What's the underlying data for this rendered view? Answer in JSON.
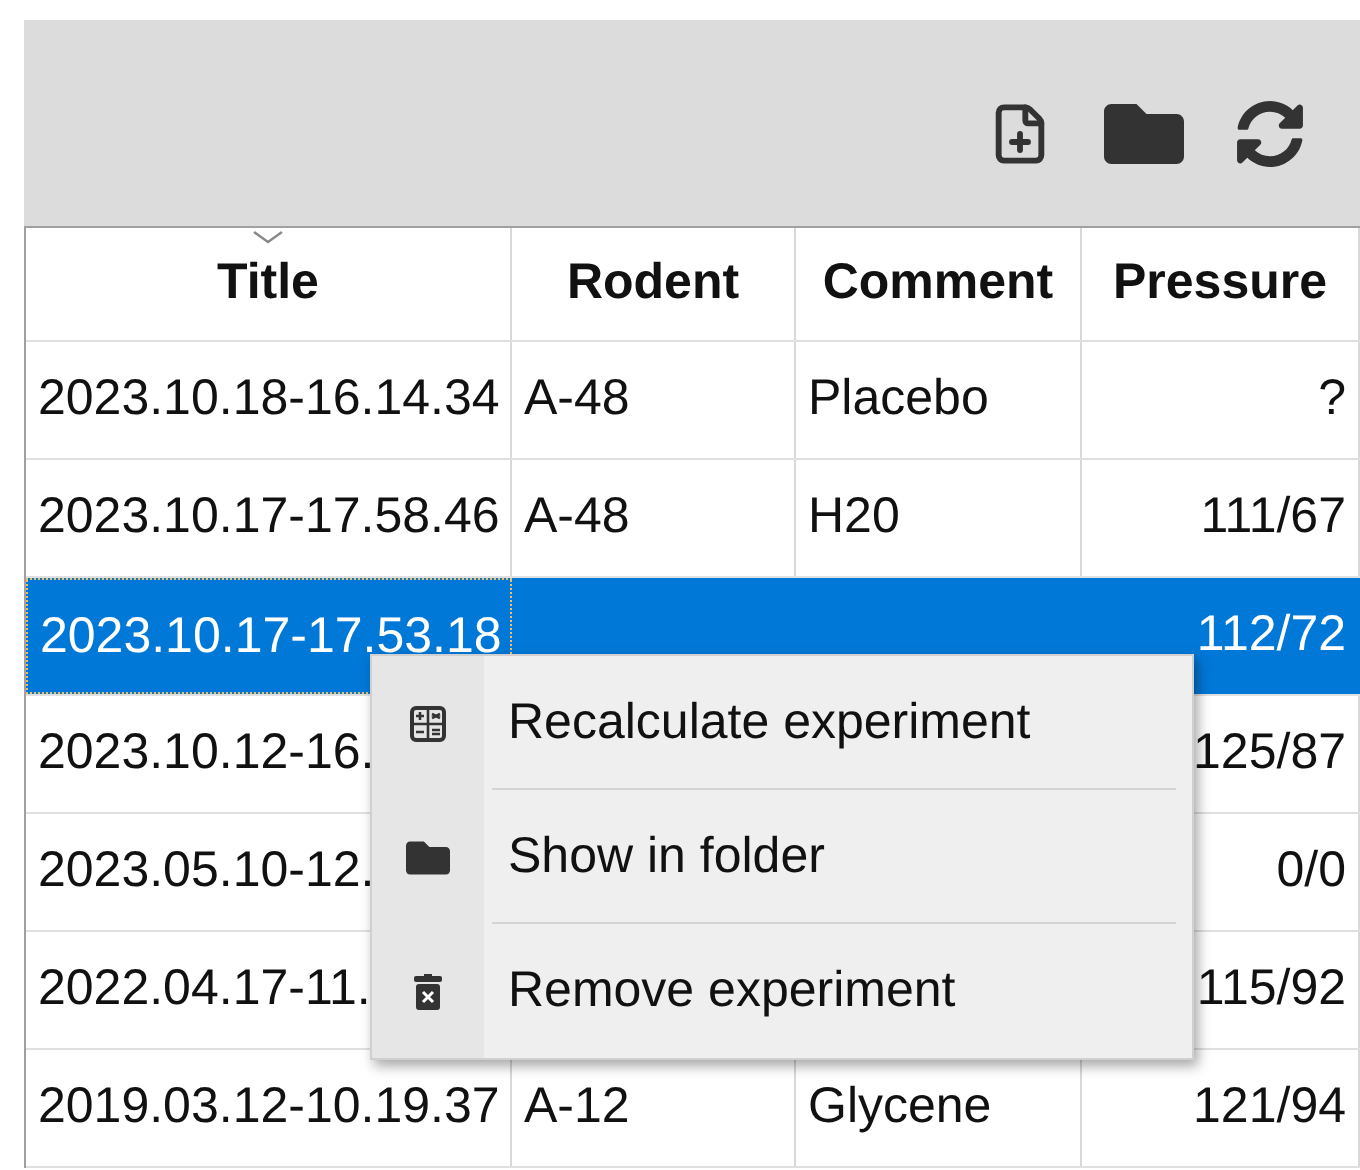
{
  "toolbar": {
    "buttons": [
      {
        "kind": "new-file"
      },
      {
        "kind": "folder"
      },
      {
        "kind": "refresh"
      }
    ]
  },
  "table": {
    "columns": [
      {
        "label": "Title",
        "sorted": true
      },
      {
        "label": "Rodent",
        "sorted": false
      },
      {
        "label": "Comment",
        "sorted": false
      },
      {
        "label": "Pressure",
        "sorted": false
      }
    ],
    "rows": [
      {
        "title": "2023.10.18-16.14.34",
        "rodent": "A-48",
        "comment": "Placebo",
        "pressure": "?",
        "selected": false
      },
      {
        "title": "2023.10.17-17.58.46",
        "rodent": "A-48",
        "comment": "H20",
        "pressure": "111/67",
        "selected": false
      },
      {
        "title": "2023.10.17-17.53.18",
        "pressure": "112/72",
        "selected": true
      },
      {
        "title": "2023.10.12-16.",
        "pressure": "125/87",
        "selected": false
      },
      {
        "title": "2023.05.10-12.",
        "pressure": "0/0",
        "selected": false
      },
      {
        "title": "2022.04.17-11.",
        "pressure": "115/92",
        "selected": false
      },
      {
        "title": "2019.03.12-10.19.37",
        "rodent": "A-12",
        "comment": "Glycene",
        "pressure": "121/94",
        "selected": false
      }
    ]
  },
  "context_menu": {
    "items": [
      {
        "kind": "calculator",
        "label": "Recalculate experiment"
      },
      {
        "kind": "folder",
        "label": "Show in folder"
      },
      {
        "kind": "trash",
        "label": "Remove experiment"
      }
    ]
  }
}
